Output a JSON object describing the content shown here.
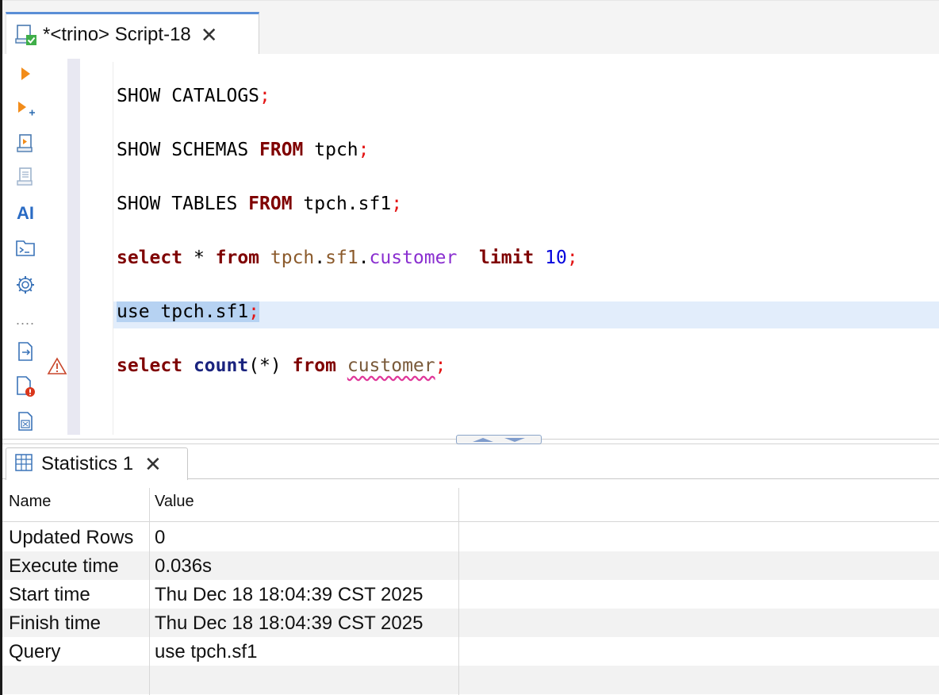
{
  "editor": {
    "tab_title": "*<trino> Script-18",
    "close_symbol": "✕",
    "lines": {
      "l1": {
        "a": "SHOW CATALOGS",
        "semi": ";"
      },
      "l2": {
        "a": "SHOW SCHEMAS ",
        "kw": "FROM",
        "b": " tpch",
        "semi": ";"
      },
      "l3": {
        "a": "SHOW TABLES ",
        "kw": "FROM",
        "b": " tpch.sf1",
        "semi": ";"
      },
      "l4": {
        "kw1": "select",
        "star": " * ",
        "kw2": "from",
        "sp": " ",
        "schema": "tpch",
        "dot1": ".",
        "db": "sf1",
        "dot2": ".",
        "table": "customer",
        "sp2": "  ",
        "kw3": "limit",
        "sp3": " ",
        "num": "10",
        "semi": ";"
      },
      "l5": {
        "text": "use tpch.sf1",
        "semi": ";"
      },
      "l6": {
        "kw1": "select",
        "sp1": " ",
        "fn": "count",
        "args": "(*) ",
        "kw2": "from",
        "sp2": " ",
        "table": "customer",
        "semi": ";"
      }
    },
    "toolbar_icons": [
      "execute-icon",
      "execute-new-tab-icon",
      "execute-script-icon",
      "execution-plan-icon",
      "ai-icon",
      "console-icon",
      "settings-icon",
      "more-icon",
      "export-icon",
      "file-error-icon",
      "variables-icon"
    ],
    "ai_label": "AI",
    "more_label": "....",
    "warning_icon": "warning-icon"
  },
  "results": {
    "tab_title": "Statistics 1",
    "close_symbol": "✕",
    "columns": {
      "name": "Name",
      "value": "Value"
    },
    "rows": [
      {
        "name": "Updated Rows",
        "value": "0"
      },
      {
        "name": "Execute time",
        "value": "0.036s"
      },
      {
        "name": "Start time",
        "value": "Thu Dec 18 18:04:39 CST 2025"
      },
      {
        "name": "Finish time",
        "value": "Thu Dec 18 18:04:39 CST 2025"
      },
      {
        "name": "Query",
        "value": "use tpch.sf1"
      }
    ]
  },
  "colors": {
    "keyword": "#7f0000",
    "semicolon": "#e31414",
    "number": "#0000dd",
    "table_name": "#8a2fd0",
    "schema_name": "#8b5a2b",
    "selection": "#b6d2f2",
    "active_tab_accent": "#5a8ed6"
  }
}
